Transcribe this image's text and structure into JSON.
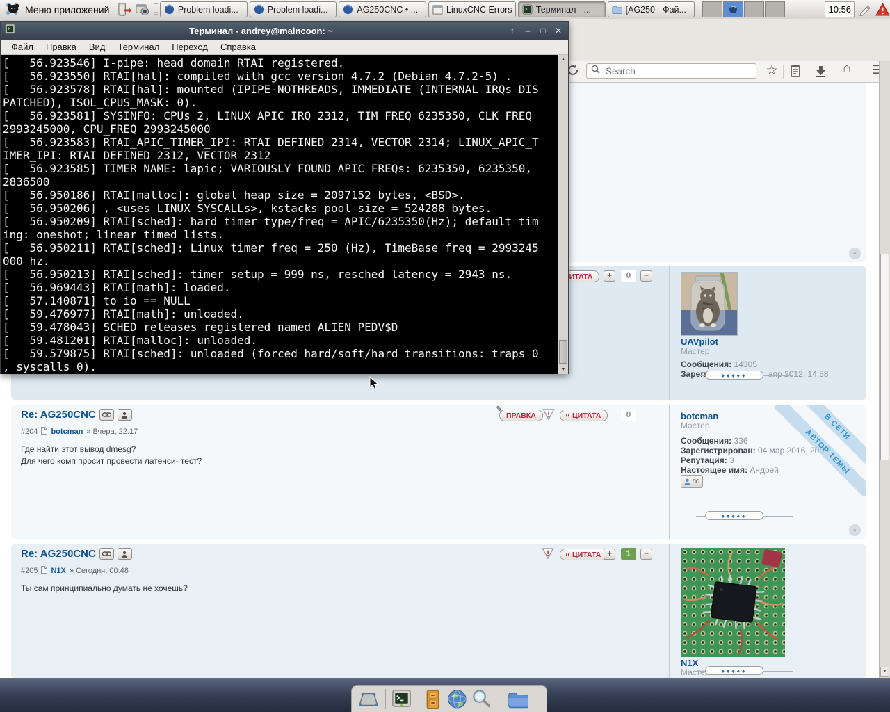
{
  "icons": {
    "stars": "♦♦♦♦♦",
    "up": "▲",
    "down": "▼",
    "star": "☆",
    "home": "⌂",
    "menu": "☰",
    "win_shade": "↑",
    "win_min": "–",
    "win_max": "□",
    "win_close": "✕",
    "plus": "+",
    "minus": "−",
    "quote_mark": "“",
    "edit_mark": "✎"
  },
  "top_panel": {
    "menu_label": "Меню приложений",
    "clock": "10:56",
    "taskbar": [
      {
        "label": "Problem loadi..."
      },
      {
        "label": "Problem loadi..."
      },
      {
        "label": "AG250CNC • ..."
      },
      {
        "label": "LinuxCNC Errors"
      },
      {
        "label": "Терминал - ..."
      },
      {
        "label": "[AG250 - Фай..."
      }
    ]
  },
  "terminal": {
    "title": "Терминал - andrey@maincoon: ~",
    "menu": [
      "Файл",
      "Правка",
      "Вид",
      "Терминал",
      "Переход",
      "Справка"
    ],
    "lines": [
      "[   56.923546] I-pipe: head domain RTAI registered.",
      "[   56.923550] RTAI[hal]: compiled with gcc version 4.7.2 (Debian 4.7.2-5) .",
      "[   56.923578] RTAI[hal]: mounted (IPIPE-NOTHREADS, IMMEDIATE (INTERNAL IRQs DIS",
      "PATCHED), ISOL_CPUS_MASK: 0).",
      "[   56.923581] SYSINFO: CPUs 2, LINUX APIC IRQ 2312, TIM_FREQ 6235350, CLK_FREQ",
      "2993245000, CPU_FREQ 2993245000",
      "[   56.923583] RTAI_APIC_TIMER_IPI: RTAI DEFINED 2314, VECTOR 2314; LINUX_APIC_T",
      "IMER_IPI: RTAI DEFINED 2312, VECTOR 2312",
      "[   56.923585] TIMER NAME: lapic; VARIOUSLY FOUND APIC FREQs: 6235350, 6235350,",
      "2836500",
      "[   56.950186] RTAI[malloc]: global heap size = 2097152 bytes, <BSD>.",
      "[   56.950206] , <uses LINUX SYSCALLs>, kstacks pool size = 524288 bytes.",
      "[   56.950209] RTAI[sched]: hard timer type/freq = APIC/6235350(Hz); default tim",
      "ing: oneshot; linear timed lists.",
      "[   56.950211] RTAI[sched]: Linux timer freq = 250 (Hz), TimeBase freq = 2993245",
      "000 hz.",
      "[   56.950213] RTAI[sched]: timer setup = 999 ns, resched latency = 2943 ns.",
      "[   56.969443] RTAI[math]: loaded.",
      "[   57.140871] to_io == NULL",
      "[   59.476977] RTAI[math]: unloaded.",
      "[   59.478043] SCHED releases registered named ALIEN PEDV$D",
      "[   59.481201] RTAI[malloc]: unloaded.",
      "[   59.579875] RTAI[sched]: unloaded (forced hard/soft/hard transitions: traps 0",
      ", syscalls 0)."
    ]
  },
  "browser": {
    "search_placeholder": "Search"
  },
  "forum": {
    "labels": {
      "posts": "Сообщения:",
      "registered": "Зарегистрирован:",
      "reputation": "Репутация:",
      "realname": "Настоящее имя:",
      "edit": "ПРАВКА",
      "quote": "ЦИТАТА",
      "pm": "лс"
    },
    "ribbons": {
      "online": "В СЕТИ",
      "author": "АВТОР ТЕМЫ"
    },
    "post_top": {
      "score": "0"
    },
    "uavpilot": {
      "username": "UAVpilot",
      "rank": "Мастер",
      "posts": "14305",
      "registered_tail": "апр 2012, 14:58"
    },
    "post204": {
      "title": "Re: AG250CNC",
      "number": "#204",
      "author": "botcman",
      "date": "» Вчера, 22:17",
      "body": [
        "Где найти этот вывод dmesg?",
        "Для чего комп просит провести латенси- тест?"
      ],
      "score": "0",
      "user": {
        "username": "botcman",
        "rank": "Мастер",
        "posts": "336",
        "registered": "04 мар 2016, 20:22",
        "reputation": "3",
        "realname": "Андрей"
      }
    },
    "post205": {
      "title": "Re: AG250CNC",
      "number": "#205",
      "author": "N1X",
      "date": "» Сегодня, 00:48",
      "body": [
        "Ты сам принципиально думать не хочешь?"
      ],
      "score": "1",
      "user": {
        "username": "N1X",
        "rank": "Мастер"
      }
    }
  }
}
